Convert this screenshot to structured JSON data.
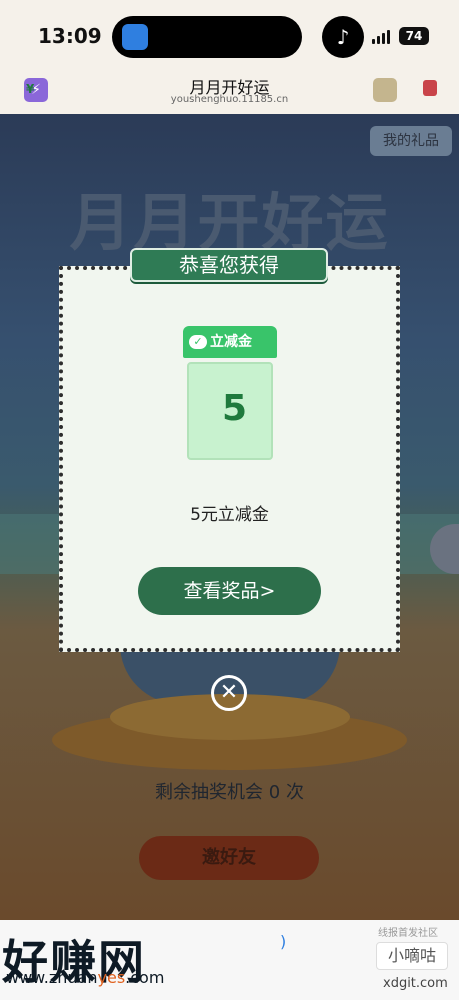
{
  "status_bar": {
    "time": "13:09",
    "battery": "74"
  },
  "title_bar": {
    "title": "月月开好运",
    "url": "youshenghuo.11185.cn"
  },
  "scene": {
    "title": "月月开好运",
    "my_gifts_label": "我的礼品",
    "remaining_text": "剩余抽奖机会 0 次",
    "invite_label": "邀好友"
  },
  "modal": {
    "banner": "恭喜您获得",
    "coupon_tag": "立减金",
    "coupon_currency": "¥",
    "coupon_amount": "5",
    "prize_name": "5元立减金",
    "view_prize_label": "查看奖品>",
    "close_glyph": "✕"
  },
  "watermarks": {
    "left_main": "好赚网",
    "left_url_prefix": "www.zhuan",
    "left_url_accent": "yes",
    "left_url_suffix": ".com",
    "right_top": "线报首发社区",
    "right_box": "小嘀咕",
    "right_url": "xdgit.com"
  }
}
